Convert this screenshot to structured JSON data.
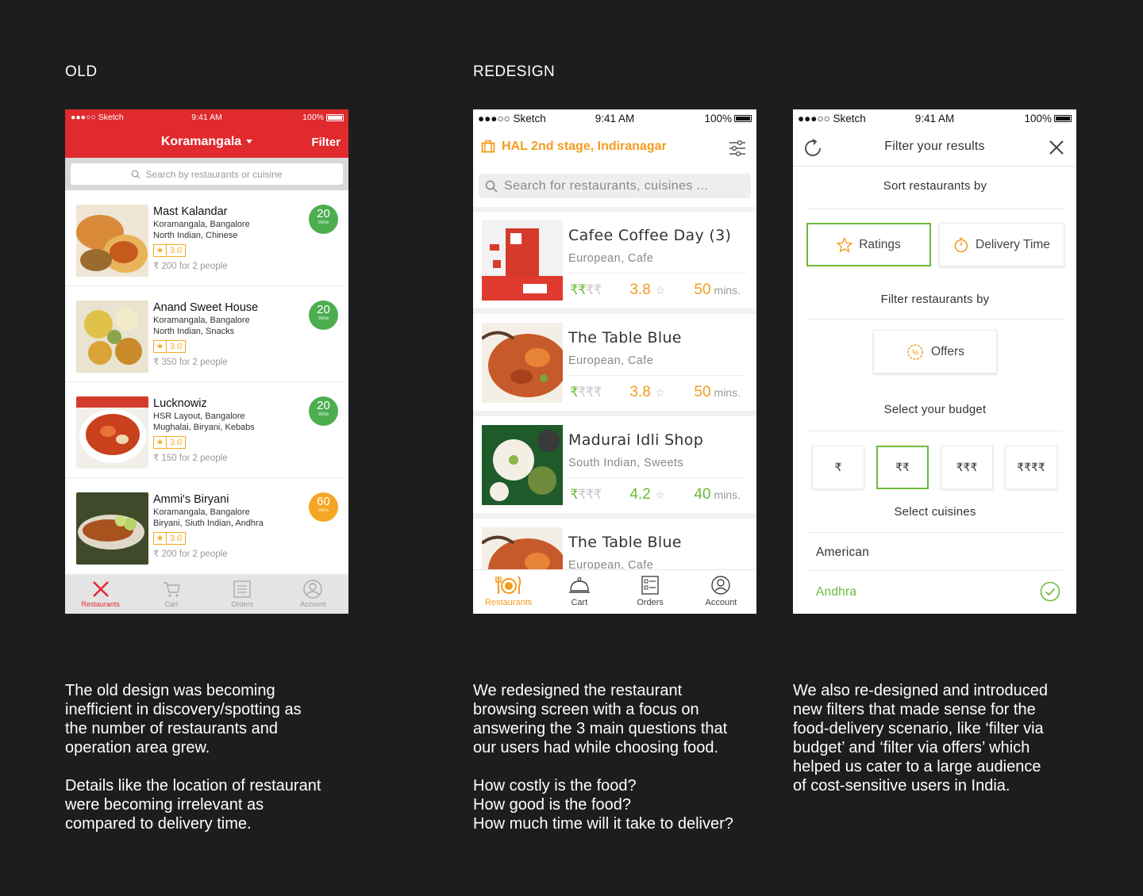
{
  "labels": {
    "old": "OLD",
    "redesign": "REDESIGN"
  },
  "captions": {
    "old": "The old design was becoming\ninefficient in discovery/spotting as\nthe number of restaurants and\noperation area grew.\n\nDetails like the location of restaurant\nwere becoming irrelevant as\ncompared to delivery time.",
    "redesign": "We redesigned the restaurant\nbrowsing screen with a focus on\nanswering the 3 main questions that\nour users had while choosing food.\n\nHow costly is the food?\nHow good is the food?\nHow much time will it take to deliver?",
    "filter": "We also re-designed and introduced\nnew filters that made sense for the\nfood-delivery scenario, like ‘filter via\nbudget’ and ‘filter via offers’ which\nhelped us cater to a large audience\nof cost-sensitive users in India."
  },
  "status_bar": {
    "carrier": "●●●○○ Sketch",
    "time": "9:41 AM",
    "battery": "100%"
  },
  "old_screen": {
    "location": "Koramangala",
    "filter": "Filter",
    "search_placeholder": "Search by restaurants or cuisine",
    "restaurants": [
      {
        "name": "Mast Kalandar",
        "area": "Koramangala, Bangalore",
        "cuisine": "North Indian, Chinese",
        "rating": "3.0",
        "price": "₹ 200 for 2 people",
        "eta": "20",
        "eta_unit": "mins",
        "badge_color": "#4cae4f"
      },
      {
        "name": "Anand Sweet House",
        "area": "Koramangala, Bangalore",
        "cuisine": "North Indian, Snacks",
        "rating": "3.0",
        "price": "₹ 350 for 2 people",
        "eta": "20",
        "eta_unit": "mins",
        "badge_color": "#4cae4f"
      },
      {
        "name": "Lucknowiz",
        "area": "HSR Layout, Bangalore",
        "cuisine": "Mughalai, Biryani, Kebabs",
        "rating": "3.0",
        "price": "₹ 150 for 2 people",
        "eta": "20",
        "eta_unit": "mins",
        "badge_color": "#4cae4f"
      },
      {
        "name": "Ammi's Biryani",
        "area": "Koramangala, Bangalore",
        "cuisine": "Biryani, Siuth Indian, Andhra",
        "rating": "3.0",
        "price": "₹ 200 for 2 people",
        "eta": "60",
        "eta_unit": "mins",
        "badge_color": "#f5a623"
      }
    ],
    "tabs": [
      "Restaurants",
      "Cart",
      "Orders",
      "Account"
    ]
  },
  "redesign_screen": {
    "location": "HAL 2nd stage, Indiranagar",
    "search_placeholder": "Search for restaurants, cuisines ...",
    "restaurants": [
      {
        "name": "Cafee Coffee Day (3)",
        "cuisine": "European, Cafe",
        "price_level": 2,
        "rating": "3.8",
        "time": "50",
        "unit": "mins."
      },
      {
        "name": "The Table Blue",
        "cuisine": "European, Cafe",
        "price_level": 1,
        "rating": "3.8",
        "time": "50",
        "unit": "mins."
      },
      {
        "name": "Madurai Idli Shop",
        "cuisine": "South Indian, Sweets",
        "price_level": 1,
        "rating": "4.2",
        "time": "40",
        "unit": "mins."
      },
      {
        "name": "The Table Blue",
        "cuisine": "European, Cafe",
        "price_level": 1,
        "rating": "",
        "time": "",
        "unit": ""
      }
    ],
    "rupee_symbols": "₹₹₹₹",
    "tabs": [
      "Restaurants",
      "Cart",
      "Orders",
      "Account"
    ]
  },
  "filter_screen": {
    "title": "Filter your results",
    "sort_heading": "Sort restaurants by",
    "sort_options": [
      "Ratings",
      "Delivery Time"
    ],
    "filter_heading": "Filter restaurants by",
    "offers": "Offers",
    "budget_heading": "Select your budget",
    "budget_options": [
      "₹",
      "₹₹",
      "₹₹₹",
      "₹₹₹₹"
    ],
    "cuisine_heading": "Select cuisines",
    "cuisines": [
      "American",
      "Andhra"
    ]
  },
  "colors": {
    "accent_orange": "#f39c1f",
    "green": "#6dbb3c",
    "old_red": "#e02a2e"
  }
}
